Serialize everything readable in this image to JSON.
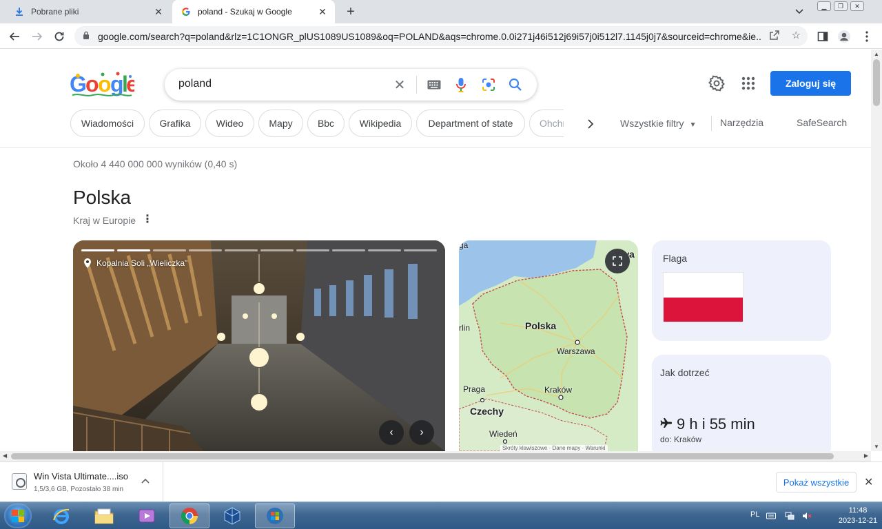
{
  "browser": {
    "tabs": [
      {
        "title": "Pobrane pliki",
        "icon": "download-icon",
        "active": false
      },
      {
        "title": "poland - Szukaj w Google",
        "icon": "google-g-icon",
        "active": true
      }
    ],
    "url": "google.com/search?q=poland&rlz=1C1ONGR_plUS1089US1089&oq=POLAND&aqs=chrome.0.0i271j46i512j69i57j0i512l7.1145j0j7&sourceid=chrome&ie..."
  },
  "search": {
    "query": "poland",
    "signin_label": "Zaloguj się",
    "chips": [
      "Wiadomości",
      "Grafika",
      "Wideo",
      "Mapy",
      "Bbc",
      "Wikipedia",
      "Department of state",
      "Ohchr"
    ],
    "all_filters": "Wszystkie filtry",
    "tools": "Narzędzia",
    "safesearch": "SafeSearch",
    "stats": "Około 4 440 000 000 wyników (0,40 s)"
  },
  "knowledge_panel": {
    "title": "Polska",
    "subtitle": "Kraj w Europie",
    "photo_caption": "Kopalnia Soli „Wieliczka\"",
    "map": {
      "country": "Polska",
      "neighbors": [
        "Litwa",
        "Czechy"
      ],
      "cities": [
        "Warszawa",
        "Kraków",
        "Praga",
        "Wiedeń"
      ],
      "partial_labels": [
        "ga",
        "rlin"
      ],
      "credits": "Skróty klawiszowe · Dane mapy · Warunki"
    },
    "flag_title": "Flaga",
    "flag_colors": [
      "#ffffff",
      "#dc143c"
    ],
    "travel_title": "Jak dotrzeć",
    "travel_time": "9 h i 55 min",
    "travel_dest": "do: Kraków"
  },
  "downloads": {
    "file_name": "Win Vista Ultimate....iso",
    "status": "1,5/3,6 GB, Pozostało 38 min",
    "show_all": "Pokaż wszystkie"
  },
  "taskbar": {
    "apps": [
      "internet-explorer-icon",
      "explorer-folder-icon",
      "media-player-icon",
      "chrome-icon",
      "virtualbox-icon",
      "windows-setup-icon"
    ],
    "language": "PL",
    "time": "11:48",
    "date": "2023-12-21"
  },
  "colors": {
    "accent": "#1a73e8",
    "taskbar": "#3e6690",
    "card_bg": "#eef1fb"
  }
}
